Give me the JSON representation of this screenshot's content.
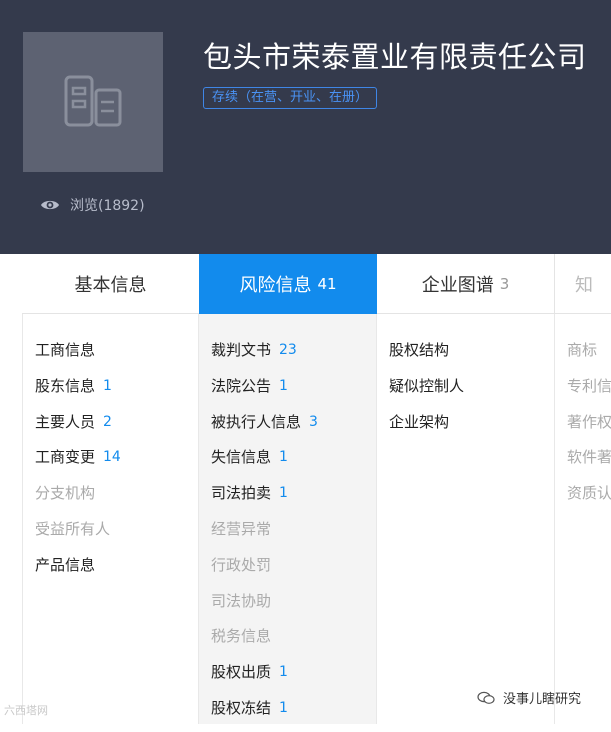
{
  "company": {
    "name": "包头市荣泰置业有限责任公司",
    "status": "存续（在营、开业、在册）",
    "views_label": "浏览(1892)"
  },
  "tabs": [
    {
      "label": "基本信息",
      "count": ""
    },
    {
      "label": "风险信息",
      "count": "41"
    },
    {
      "label": "企业图谱",
      "count": "3"
    },
    {
      "label": "知",
      "count": ""
    }
  ],
  "columns": {
    "basic": [
      {
        "label": "工商信息",
        "count": ""
      },
      {
        "label": "股东信息",
        "count": "1"
      },
      {
        "label": "主要人员",
        "count": "2"
      },
      {
        "label": "工商变更",
        "count": "14"
      },
      {
        "label": "分支机构",
        "count": ""
      },
      {
        "label": "受益所有人",
        "count": ""
      },
      {
        "label": "产品信息",
        "count": ""
      }
    ],
    "risk": [
      {
        "label": "裁判文书",
        "count": "23"
      },
      {
        "label": "法院公告",
        "count": "1"
      },
      {
        "label": "被执行人信息",
        "count": "3"
      },
      {
        "label": "失信信息",
        "count": "1"
      },
      {
        "label": "司法拍卖",
        "count": "1"
      },
      {
        "label": "经营异常",
        "count": ""
      },
      {
        "label": "行政处罚",
        "count": ""
      },
      {
        "label": "司法协助",
        "count": ""
      },
      {
        "label": "税务信息",
        "count": ""
      },
      {
        "label": "股权出质",
        "count": "1"
      },
      {
        "label": "股权冻结",
        "count": "1"
      }
    ],
    "graph": [
      {
        "label": "股权结构",
        "count": ""
      },
      {
        "label": "疑似控制人",
        "count": ""
      },
      {
        "label": "企业架构",
        "count": ""
      }
    ],
    "ip": [
      {
        "label": "商标",
        "count": ""
      },
      {
        "label": "专利信",
        "count": ""
      },
      {
        "label": "著作权",
        "count": ""
      },
      {
        "label": "软件著",
        "count": ""
      },
      {
        "label": "资质认",
        "count": ""
      }
    ]
  },
  "watermarks": {
    "left": "六西塔网",
    "right": "没事儿瞎研究"
  },
  "colors": {
    "header_bg": "#343a4c",
    "accent_blue": "#128bed",
    "muted_text": "#aaaaaa"
  }
}
